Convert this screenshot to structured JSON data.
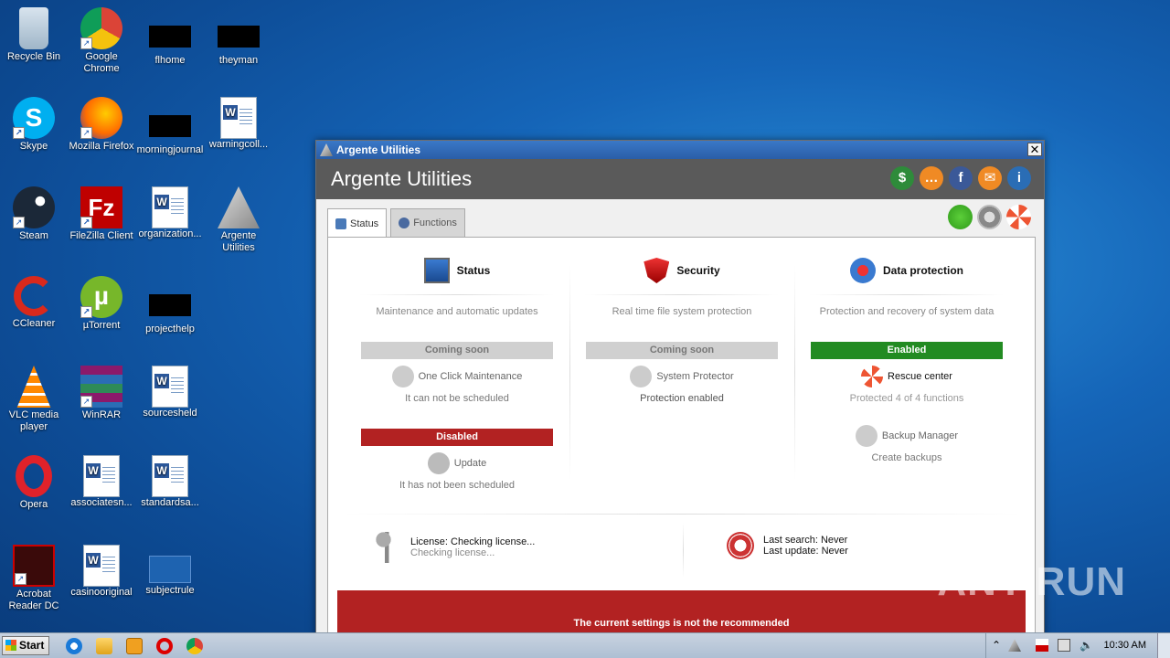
{
  "desktop": {
    "icons": [
      {
        "label": "Recycle Bin"
      },
      {
        "label": "Google Chrome"
      },
      {
        "label": "flhome"
      },
      {
        "label": "theyman"
      },
      {
        "label": "Skype"
      },
      {
        "label": "Mozilla Firefox"
      },
      {
        "label": "morningjournal"
      },
      {
        "label": "warningcoll..."
      },
      {
        "label": "Steam"
      },
      {
        "label": "FileZilla Client"
      },
      {
        "label": "organization..."
      },
      {
        "label": "Argente Utilities"
      },
      {
        "label": "CCleaner"
      },
      {
        "label": "µTorrent"
      },
      {
        "label": "projecthelp"
      },
      {
        "label": "VLC media player"
      },
      {
        "label": "WinRAR"
      },
      {
        "label": "sourcesheld"
      },
      {
        "label": "Opera"
      },
      {
        "label": "associatesn..."
      },
      {
        "label": "standardsa..."
      },
      {
        "label": "Acrobat Reader DC"
      },
      {
        "label": "casinooriginal"
      },
      {
        "label": "subjectrule"
      }
    ]
  },
  "window": {
    "title": "Argente Utilities",
    "close_glyph": "✕",
    "header_title": "Argente Utilities",
    "tabs": [
      {
        "label": "Status"
      },
      {
        "label": "Functions"
      }
    ],
    "columns": [
      {
        "title": "Status",
        "subtitle": "Maintenance and automatic updates",
        "badge1": "Coming soon",
        "feature1": "One Click Maintenance",
        "feature1_sub": "It can not be scheduled",
        "badge2": "Disabled",
        "feature2": "Update",
        "feature2_sub": "It has not been scheduled"
      },
      {
        "title": "Security",
        "subtitle": "Real time file system protection",
        "badge1": "Coming soon",
        "feature1": "System Protector",
        "feature1_sub": "Protection enabled"
      },
      {
        "title": "Data protection",
        "subtitle": "Protection and recovery of system data",
        "badge1": "Enabled",
        "feature1": "Rescue center",
        "feature1_sub": "Protected 4 of 4 functions",
        "feature2": "Backup Manager",
        "feature2_sub": "Create backups"
      }
    ],
    "license": {
      "line1": "License: Checking license...",
      "line2": "Checking license..."
    },
    "search": {
      "line1": "Last search: Never",
      "line2": "Last update: Never"
    },
    "alert": "The current settings is not the recommended"
  },
  "taskbar": {
    "start_label": "Start",
    "clock": "10:30 AM"
  },
  "watermark": "ANY RUN",
  "colors": {
    "enabled": "#228b22",
    "disabled": "#b22222",
    "header": "#5a5a5a"
  }
}
